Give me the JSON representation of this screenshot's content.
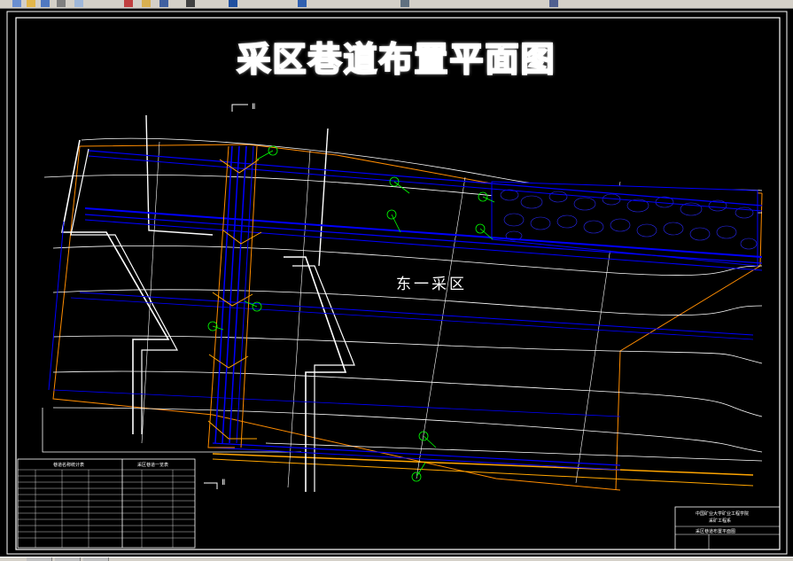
{
  "drawing": {
    "title": "采区巷道布置平面图",
    "area_label": "东一采区",
    "section_label_top": "Ⅱ",
    "section_label_bottom": "Ⅱ"
  },
  "tables": {
    "left_title": "巷道名称统计表",
    "right_title": "采区巷道一览表"
  },
  "title_block": {
    "line1": "中国矿业大学矿业工程学院",
    "line2": "采矿工程系",
    "drawing_name": "采区巷道布置平面图"
  },
  "colors": {
    "background": "#000000",
    "roadway": "#0000ff",
    "contour": "#ffffff",
    "boundary": "#ff8c00",
    "annotation": "#00ff00",
    "border": "#ffffff"
  },
  "icons": [
    "new-file-icon",
    "open-icon",
    "save-icon",
    "print-icon",
    "cut-icon",
    "copy-icon",
    "paste-icon",
    "undo-icon",
    "redo-icon",
    "zoom-icon",
    "pan-icon",
    "properties-icon",
    "layers-icon"
  ]
}
